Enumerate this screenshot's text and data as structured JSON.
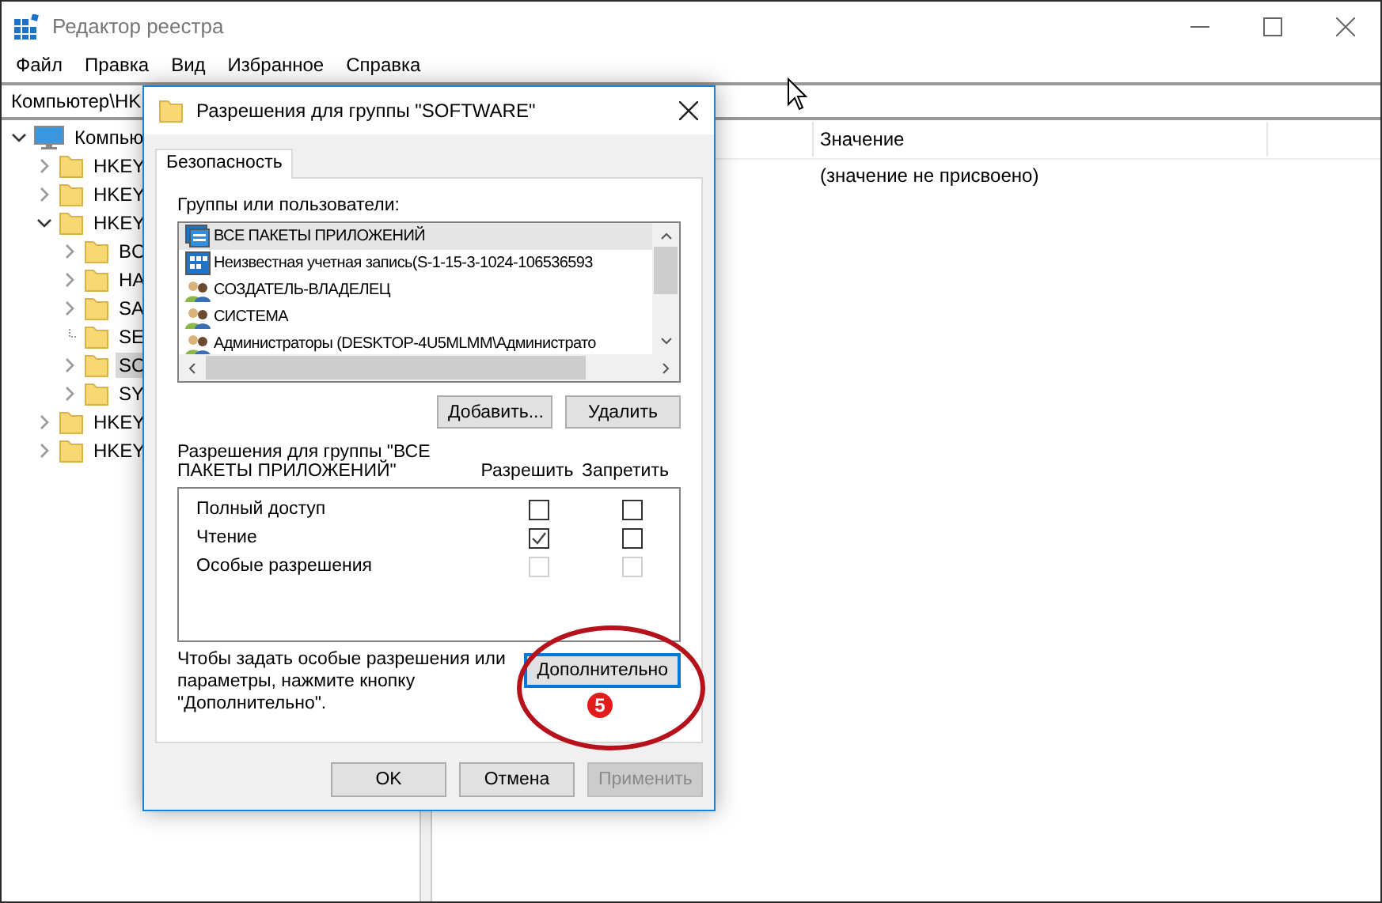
{
  "window": {
    "title": "Редактор реестра"
  },
  "menu": [
    "Файл",
    "Правка",
    "Вид",
    "Избранное",
    "Справка"
  ],
  "address": "Компьютер\\HK",
  "tree": [
    {
      "label": "Компью",
      "expandable": true,
      "expanded": true,
      "selected": false,
      "children": [
        {
          "label": "HKEY",
          "expandable": true,
          "expanded": false,
          "selected": false
        },
        {
          "label": "HKEY",
          "expandable": true,
          "expanded": false,
          "selected": false
        },
        {
          "label": "HKEY",
          "expandable": true,
          "expanded": true,
          "selected": false,
          "children": [
            {
              "label": "BC",
              "expandable": true,
              "expanded": false,
              "selected": false
            },
            {
              "label": "HA",
              "expandable": true,
              "expanded": false,
              "selected": false
            },
            {
              "label": "SA",
              "expandable": true,
              "expanded": false,
              "selected": false
            },
            {
              "label": "SE",
              "expandable": false,
              "expanded": false,
              "selected": false
            },
            {
              "label": "SO",
              "expandable": true,
              "expanded": false,
              "selected": true
            },
            {
              "label": "SY",
              "expandable": true,
              "expanded": false,
              "selected": false
            }
          ]
        },
        {
          "label": "HKEY",
          "expandable": true,
          "expanded": false,
          "selected": false
        },
        {
          "label": "HKEY",
          "expandable": true,
          "expanded": false,
          "selected": false
        }
      ]
    }
  ],
  "values": {
    "columns": [
      "Значение"
    ],
    "rows": [
      [
        "(значение не присвоено)"
      ]
    ]
  },
  "dialog": {
    "title": "Разрешения для группы \"SOFTWARE\"",
    "tabs": [
      {
        "label": "Безопасность",
        "selected": true
      }
    ],
    "users_label": "Группы или пользователи:",
    "users": [
      {
        "kind": "package",
        "name": "ВСЕ ПАКЕТЫ ПРИЛОЖЕНИЙ",
        "selected": true
      },
      {
        "kind": "account",
        "name": "Неизвестная учетная запись(S-1-15-3-1024-106536593",
        "selected": false
      },
      {
        "kind": "group",
        "name": "СОЗДАТЕЛЬ-ВЛАДЕЛЕЦ",
        "selected": false
      },
      {
        "kind": "group",
        "name": "СИСТЕМА",
        "selected": false
      },
      {
        "kind": "group",
        "name": "Администраторы (DESKTOP-4U5MLMM\\Администрато",
        "selected": false
      }
    ],
    "user_buttons": [
      "Добавить...",
      "Удалить"
    ],
    "permissions_label": "Разрешения для группы \"ВСЕ ПАКЕТЫ ПРИЛОЖЕНИЙ\"",
    "permission_columns": [
      "Разрешить",
      "Запретить"
    ],
    "permissions": [
      {
        "name": "Полный доступ",
        "allow": false,
        "deny": false,
        "disabled": false
      },
      {
        "name": "Чтение",
        "allow": true,
        "deny": false,
        "disabled": false
      },
      {
        "name": "Особые разрешения",
        "allow": false,
        "deny": false,
        "disabled": true
      }
    ],
    "hint": "Чтобы задать особые разрешения или параметры, нажмите кнопку \"Дополнительно\".",
    "advanced_button": {
      "label": "Дополнительно",
      "focused": true
    },
    "buttons": [
      {
        "label": "OK",
        "disabled": false
      },
      {
        "label": "Отмена",
        "disabled": false
      },
      {
        "label": "Применить",
        "disabled": true
      }
    ]
  },
  "annotation": {
    "badge": "5"
  }
}
